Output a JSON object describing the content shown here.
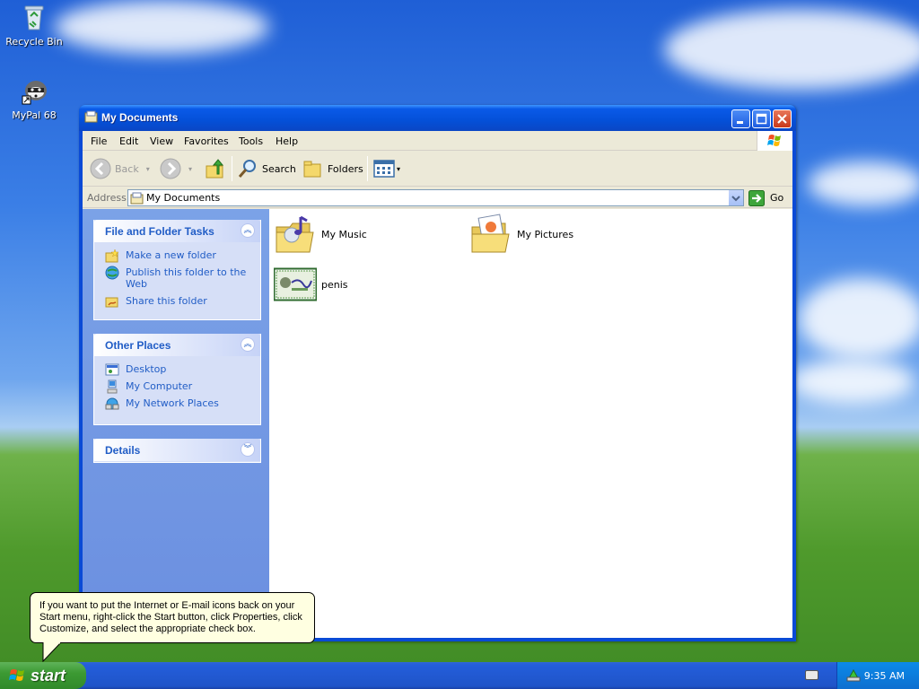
{
  "desktop": {
    "icons": [
      {
        "label": "Recycle Bin",
        "icon": "recycle-bin-icon"
      },
      {
        "label": "MyPal 68",
        "icon": "mypal-icon"
      }
    ]
  },
  "window": {
    "title": "My Documents",
    "menu": [
      "File",
      "Edit",
      "View",
      "Favorites",
      "Tools",
      "Help"
    ],
    "toolbar": {
      "back": "Back",
      "search": "Search",
      "folders": "Folders"
    },
    "address": {
      "label": "Address",
      "value": "My Documents",
      "go": "Go"
    },
    "taskpane": {
      "file_folder_tasks": {
        "title": "File and Folder Tasks",
        "items": [
          "Make a new folder",
          "Publish this folder to the Web",
          "Share this folder"
        ]
      },
      "other_places": {
        "title": "Other Places",
        "items": [
          "Desktop",
          "My Computer",
          "My Network Places"
        ]
      },
      "details": {
        "title": "Details"
      }
    },
    "files": [
      {
        "name": "My Music",
        "icon": "music-folder-icon"
      },
      {
        "name": "My Pictures",
        "icon": "pictures-folder-icon"
      },
      {
        "name": "penis",
        "icon": "image-file-icon"
      }
    ]
  },
  "balloon": {
    "text": "If you want to put the Internet or E-mail icons back on your Start menu, right-click the Start button, click Properties, click Customize, and select the appropriate check box."
  },
  "taskbar": {
    "start_label": "start",
    "time": "9:35 AM"
  },
  "colors": {
    "titlebar": "#0a5ae8",
    "taskpane_link": "#215dc6",
    "start_green": "#3c9a33",
    "balloon_bg": "#ffffe1"
  }
}
